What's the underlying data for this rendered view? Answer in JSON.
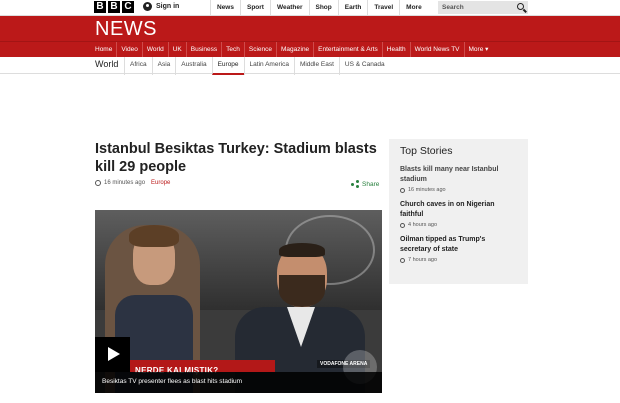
{
  "masthead": {
    "logo": [
      "B",
      "B",
      "C"
    ],
    "sign_in": "Sign in",
    "top_links": [
      "News",
      "Sport",
      "Weather",
      "Shop",
      "Earth",
      "Travel",
      "More"
    ],
    "search_placeholder": "Search"
  },
  "news_band": {
    "title": "NEWS",
    "nav": [
      "Home",
      "Video",
      "World",
      "UK",
      "Business",
      "Tech",
      "Science",
      "Magazine",
      "Entertainment & Arts",
      "Health",
      "World News TV",
      "More ▾"
    ]
  },
  "subnav": {
    "section": "World",
    "items": [
      "Africa",
      "Asia",
      "Australia",
      "Europe",
      "Latin America",
      "Middle East",
      "US & Canada"
    ],
    "active": "Europe"
  },
  "article": {
    "headline": "Istanbul Besiktas Turkey: Stadium blasts kill 29 people",
    "time": "16 minutes ago",
    "region": "Europe",
    "share": "Share",
    "video": {
      "overlay_text": "NERDE KALMIŞTIK?",
      "watermark": "VODAFONE ARENA",
      "caption": "Besiktas TV presenter flees as blast hits stadium"
    }
  },
  "top_stories": {
    "title": "Top Stories",
    "items": [
      {
        "title": "Blasts kill many near Istanbul stadium",
        "time": "16 minutes ago"
      },
      {
        "title": "Church caves in on Nigerian faithful",
        "time": "4 hours ago"
      },
      {
        "title": "Oilman tipped as Trump's secretary of state",
        "time": "7 hours ago"
      }
    ]
  },
  "colors": {
    "brand_red": "#bb1919",
    "share_green": "#28803e"
  }
}
